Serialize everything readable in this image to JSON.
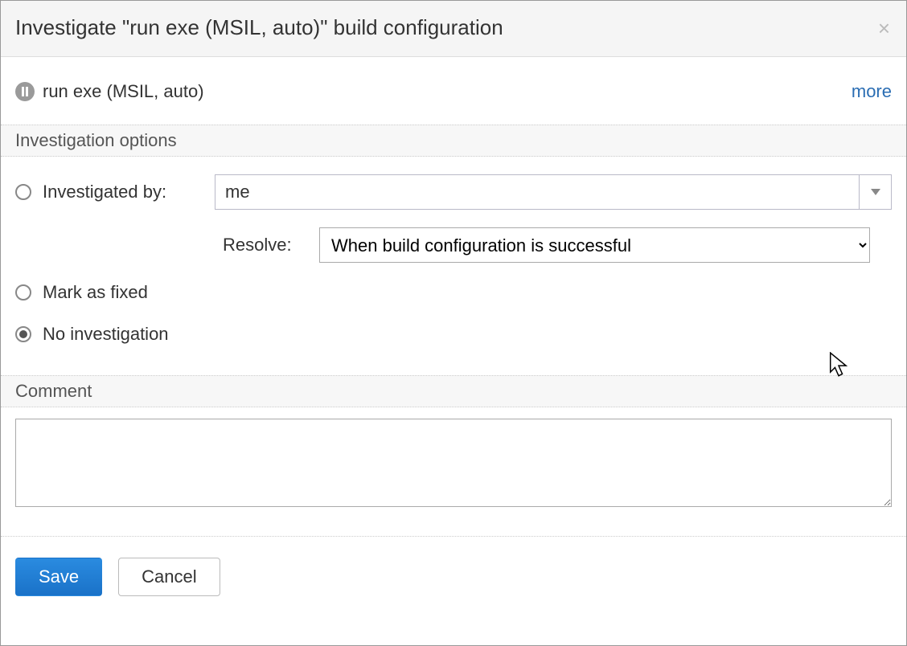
{
  "dialog": {
    "title": "Investigate \"run exe (MSIL, auto)\" build configuration",
    "config_name": "run exe (MSIL, auto)",
    "more_link": "more"
  },
  "sections": {
    "investigation_header": "Investigation options",
    "comment_header": "Comment"
  },
  "options": {
    "investigated_by_label": "Investigated by:",
    "investigated_by_value": "me",
    "resolve_label": "Resolve:",
    "resolve_options": [
      "When build configuration is successful"
    ],
    "resolve_selected": "When build configuration is successful",
    "mark_fixed_label": "Mark as fixed",
    "no_investigation_label": "No investigation",
    "selected": "no_investigation"
  },
  "comment": {
    "value": ""
  },
  "buttons": {
    "save": "Save",
    "cancel": "Cancel"
  },
  "icons": {
    "pause": "pause-icon",
    "close": "close-icon",
    "dropdown": "chevron-down-icon"
  }
}
